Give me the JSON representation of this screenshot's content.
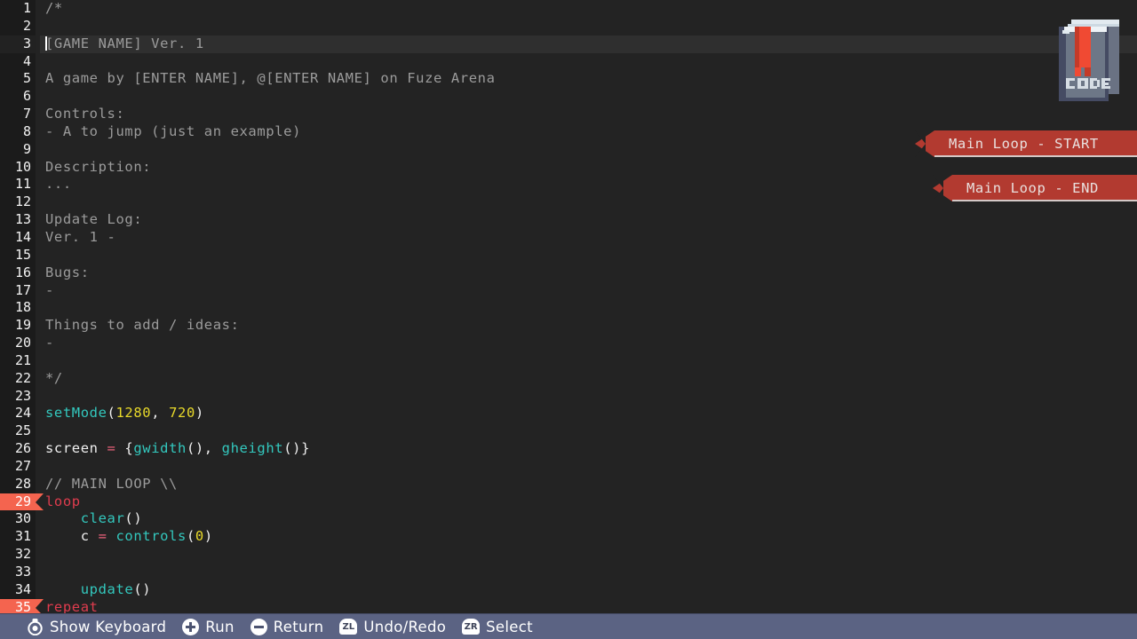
{
  "editor": {
    "active_line": 3,
    "marked_lines": [
      29,
      35
    ],
    "lines": [
      {
        "n": 1,
        "tokens": [
          {
            "t": "/*",
            "c": "c-comment"
          }
        ]
      },
      {
        "n": 2,
        "tokens": []
      },
      {
        "n": 3,
        "tokens": [
          {
            "t": "[GAME NAME] Ver. 1",
            "c": "c-comment"
          }
        ],
        "caret": true
      },
      {
        "n": 4,
        "tokens": []
      },
      {
        "n": 5,
        "tokens": [
          {
            "t": "A game by [ENTER NAME], @[ENTER NAME] on Fuze Arena",
            "c": "c-comment"
          }
        ]
      },
      {
        "n": 6,
        "tokens": []
      },
      {
        "n": 7,
        "tokens": [
          {
            "t": "Controls:",
            "c": "c-comment"
          }
        ]
      },
      {
        "n": 8,
        "tokens": [
          {
            "t": "- A to jump (just an example)",
            "c": "c-comment"
          }
        ]
      },
      {
        "n": 9,
        "tokens": []
      },
      {
        "n": 10,
        "tokens": [
          {
            "t": "Description:",
            "c": "c-comment"
          }
        ]
      },
      {
        "n": 11,
        "tokens": [
          {
            "t": "...",
            "c": "c-comment"
          }
        ]
      },
      {
        "n": 12,
        "tokens": []
      },
      {
        "n": 13,
        "tokens": [
          {
            "t": "Update Log:",
            "c": "c-comment"
          }
        ]
      },
      {
        "n": 14,
        "tokens": [
          {
            "t": "Ver. 1 -",
            "c": "c-comment"
          }
        ]
      },
      {
        "n": 15,
        "tokens": []
      },
      {
        "n": 16,
        "tokens": [
          {
            "t": "Bugs:",
            "c": "c-comment"
          }
        ]
      },
      {
        "n": 17,
        "tokens": [
          {
            "t": "-",
            "c": "c-comment"
          }
        ]
      },
      {
        "n": 18,
        "tokens": []
      },
      {
        "n": 19,
        "tokens": [
          {
            "t": "Things to add / ideas:",
            "c": "c-comment"
          }
        ]
      },
      {
        "n": 20,
        "tokens": [
          {
            "t": "-",
            "c": "c-comment"
          }
        ]
      },
      {
        "n": 21,
        "tokens": []
      },
      {
        "n": 22,
        "tokens": [
          {
            "t": "*/",
            "c": "c-comment"
          }
        ]
      },
      {
        "n": 23,
        "tokens": []
      },
      {
        "n": 24,
        "tokens": [
          {
            "t": "setMode",
            "c": "c-fn"
          },
          {
            "t": "(",
            "c": "c-plain"
          },
          {
            "t": "1280",
            "c": "c-num"
          },
          {
            "t": ", ",
            "c": "c-plain"
          },
          {
            "t": "720",
            "c": "c-num"
          },
          {
            "t": ")",
            "c": "c-plain"
          }
        ]
      },
      {
        "n": 25,
        "tokens": []
      },
      {
        "n": 26,
        "tokens": [
          {
            "t": "screen ",
            "c": "c-plain"
          },
          {
            "t": "=",
            "c": "c-op"
          },
          {
            "t": " {",
            "c": "c-plain"
          },
          {
            "t": "gwidth",
            "c": "c-fn"
          },
          {
            "t": "(), ",
            "c": "c-plain"
          },
          {
            "t": "gheight",
            "c": "c-fn"
          },
          {
            "t": "()}",
            "c": "c-plain"
          }
        ]
      },
      {
        "n": 27,
        "tokens": []
      },
      {
        "n": 28,
        "tokens": [
          {
            "t": "// MAIN LOOP \\\\",
            "c": "c-comment"
          }
        ]
      },
      {
        "n": 29,
        "tokens": [
          {
            "t": "loop",
            "c": "c-kw"
          }
        ],
        "marked": true
      },
      {
        "n": 30,
        "tokens": [
          {
            "t": "    ",
            "c": "c-plain"
          },
          {
            "t": "clear",
            "c": "c-fn"
          },
          {
            "t": "()",
            "c": "c-plain"
          }
        ]
      },
      {
        "n": 31,
        "tokens": [
          {
            "t": "    c ",
            "c": "c-plain"
          },
          {
            "t": "=",
            "c": "c-op"
          },
          {
            "t": " ",
            "c": "c-plain"
          },
          {
            "t": "controls",
            "c": "c-fn"
          },
          {
            "t": "(",
            "c": "c-plain"
          },
          {
            "t": "0",
            "c": "c-num"
          },
          {
            "t": ")",
            "c": "c-plain"
          }
        ]
      },
      {
        "n": 32,
        "tokens": []
      },
      {
        "n": 33,
        "tokens": []
      },
      {
        "n": 34,
        "tokens": [
          {
            "t": "    ",
            "c": "c-plain"
          },
          {
            "t": "update",
            "c": "c-fn"
          },
          {
            "t": "()",
            "c": "c-plain"
          }
        ]
      },
      {
        "n": 35,
        "tokens": [
          {
            "t": "repeat",
            "c": "c-kw"
          }
        ],
        "marked": true
      }
    ]
  },
  "logo": {
    "icon_name": "code-book-icon",
    "label": "CODE"
  },
  "banners": [
    {
      "id": "start",
      "label": "Main Loop - START",
      "color": "#b23a30"
    },
    {
      "id": "end",
      "label": "Main Loop - END",
      "color": "#b23a30"
    }
  ],
  "toolbar": {
    "background": "#5b6383",
    "items": [
      {
        "icon": "left-stick-icon",
        "label": "Show Keyboard"
      },
      {
        "icon": "plus-button-icon",
        "label": "Run"
      },
      {
        "icon": "minus-button-icon",
        "label": "Return"
      },
      {
        "icon": "zl-button-icon",
        "glyph": "ZL",
        "label": "Undo/Redo"
      },
      {
        "icon": "zr-button-icon",
        "glyph": "ZR",
        "label": "Select"
      }
    ]
  },
  "colors": {
    "editor_bg": "#232323",
    "gutter_bg": "#1b1b1b",
    "active_line_bg": "#2f2f2f",
    "marker": "#f4644f",
    "comment": "#9b9b9b",
    "function": "#33c8be",
    "number": "#e8d92a",
    "operator": "#e8607a",
    "keyword": "#e03c4e",
    "banner": "#b23a30",
    "toolbar": "#5b6383"
  }
}
